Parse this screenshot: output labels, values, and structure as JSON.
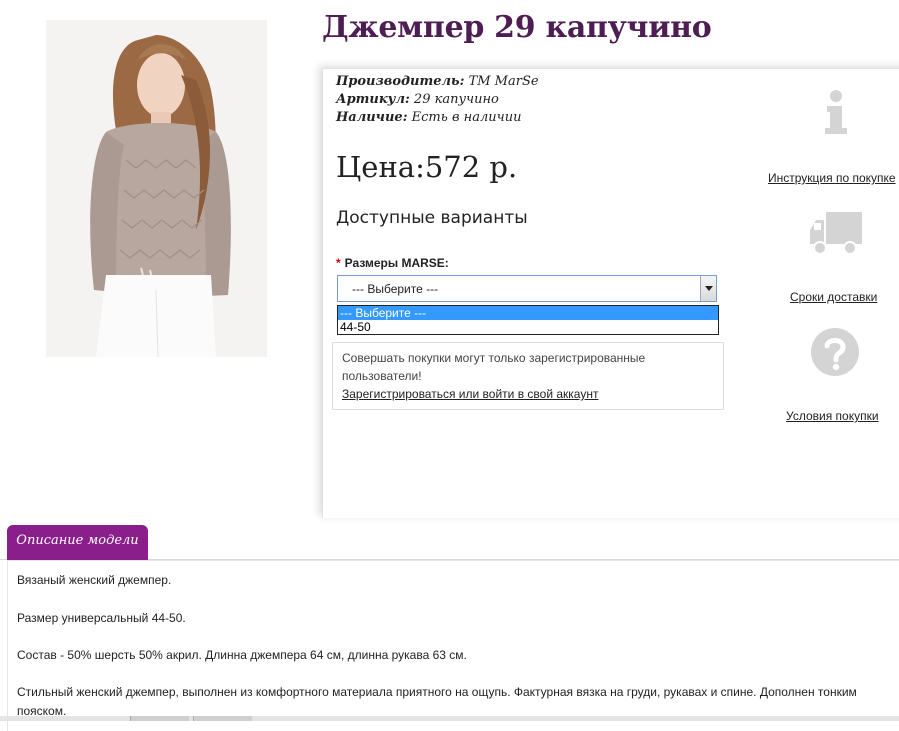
{
  "product": {
    "title": "Джемпер 29 капучино",
    "manufacturer_label": "Производитель:",
    "manufacturer_value": "TM MarSe",
    "sku_label": "Артикул:",
    "sku_value": "29 капучино",
    "availability_label": "Наличие:",
    "availability_value": "Есть в наличии",
    "price": "Цена:572 р.",
    "variants_heading": "Доступные варианты"
  },
  "size_select": {
    "required_mark": "*",
    "label": "Размеры MARSE:",
    "selected": "--- Выберите ---",
    "options": [
      "--- Выберите ---",
      "44-50"
    ]
  },
  "notice": {
    "text": "Совершать покупки могут только зарегистрированные пользователи!",
    "link": "Зарегистрироваться или войти в свой аккаунт"
  },
  "sidebar": {
    "items": [
      {
        "label": "Инструкция по покупке",
        "icon": "info-icon"
      },
      {
        "label": "Сроки доставки",
        "icon": "truck-icon"
      },
      {
        "label": "Условия покупки",
        "icon": "question-icon"
      }
    ]
  },
  "tabs": {
    "description": "Описание модели"
  },
  "description": {
    "p1": "Вязаный женский джемпер.",
    "p2": "Размер универсальный 44-50.",
    "p3": "Состав - 50% шерсть 50% акрил. Длинна джемпера 64 см, длинна рукава 63 см.",
    "p4": "Стильный женский джемпер, выполнен из комфортного материала приятного на ощупь. Фактурная вязка на груди, рукавах и спине. Дополнен тонким пояском."
  },
  "colors": {
    "title": "#4e1d54",
    "tab": "#8a1f8b",
    "select_highlight": "#3399ff",
    "icon_gray": "#d4d4d4"
  }
}
